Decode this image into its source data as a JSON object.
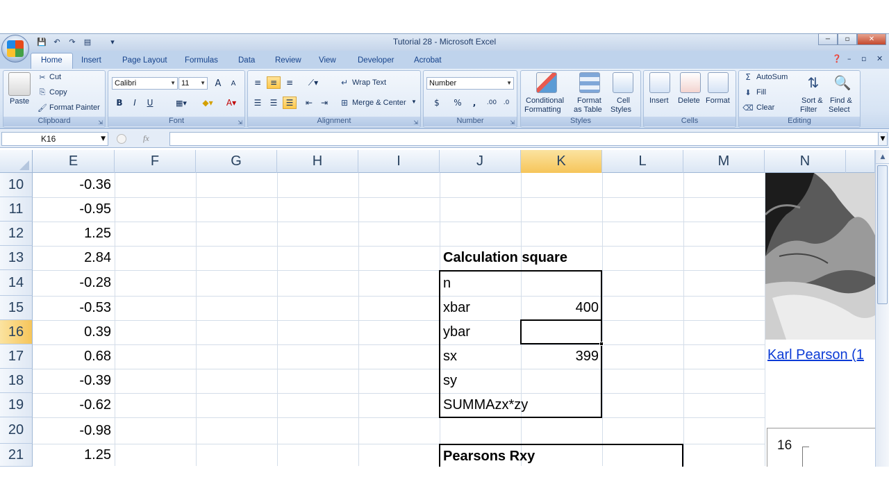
{
  "window": {
    "title": "Tutorial 28 - Microsoft Excel",
    "controls": [
      "−",
      "▫",
      "✕"
    ]
  },
  "tabs": [
    "Home",
    "Insert",
    "Page Layout",
    "Formulas",
    "Data",
    "Review",
    "View",
    "Developer",
    "Acrobat"
  ],
  "ribbon": {
    "clipboard": {
      "label": "Clipboard",
      "paste": "Paste",
      "cut": "Cut",
      "copy": "Copy",
      "format_painter": "Format Painter"
    },
    "font": {
      "label": "Font",
      "name": "Calibri",
      "size": "11",
      "bold": "B",
      "italic": "I",
      "underline": "U"
    },
    "alignment": {
      "label": "Alignment",
      "wrap_text": "Wrap Text",
      "merge_center": "Merge & Center"
    },
    "number": {
      "label": "Number",
      "format": "Number",
      "currency": "$",
      "percent": "%",
      "comma": ","
    },
    "styles": {
      "label": "Styles",
      "conditional": [
        "Conditional",
        "Formatting"
      ],
      "format_table": [
        "Format",
        "as Table"
      ],
      "cell_styles": [
        "Cell",
        "Styles"
      ]
    },
    "cells": {
      "label": "Cells",
      "insert": "Insert",
      "delete": "Delete",
      "format": "Format"
    },
    "editing": {
      "label": "Editing",
      "autosum": "AutoSum",
      "fill": "Fill",
      "clear": "Clear",
      "sort_filter": [
        "Sort &",
        "Filter"
      ],
      "find_select": [
        "Find &",
        "Select"
      ]
    }
  },
  "formula_bar": {
    "name_box": "K16",
    "fx": "fx",
    "content": ""
  },
  "columns": [
    "E",
    "F",
    "G",
    "H",
    "I",
    "J",
    "K",
    "L",
    "M",
    "N"
  ],
  "selected_column": "K",
  "rows": [
    "10",
    "11",
    "12",
    "13",
    "14",
    "15",
    "16",
    "17",
    "18",
    "19",
    "20",
    "21"
  ],
  "selected_row": "16",
  "column_e": [
    "-0.36",
    "-0.95",
    "1.25",
    "2.84",
    "-0.28",
    "-0.53",
    "0.39",
    "0.68",
    "-0.39",
    "-0.62",
    "-0.98",
    "1.25"
  ],
  "calc": {
    "heading": "Calculation square",
    "labels": [
      "n",
      "xbar",
      "ybar",
      "sx",
      "sy",
      "SUMMAzx*zy"
    ],
    "values": [
      "",
      "400",
      "",
      "399",
      "",
      ""
    ]
  },
  "pearson": {
    "heading": "Pearsons Rxy"
  },
  "link_text": "Karl Pearson (1",
  "shape_text": "16"
}
